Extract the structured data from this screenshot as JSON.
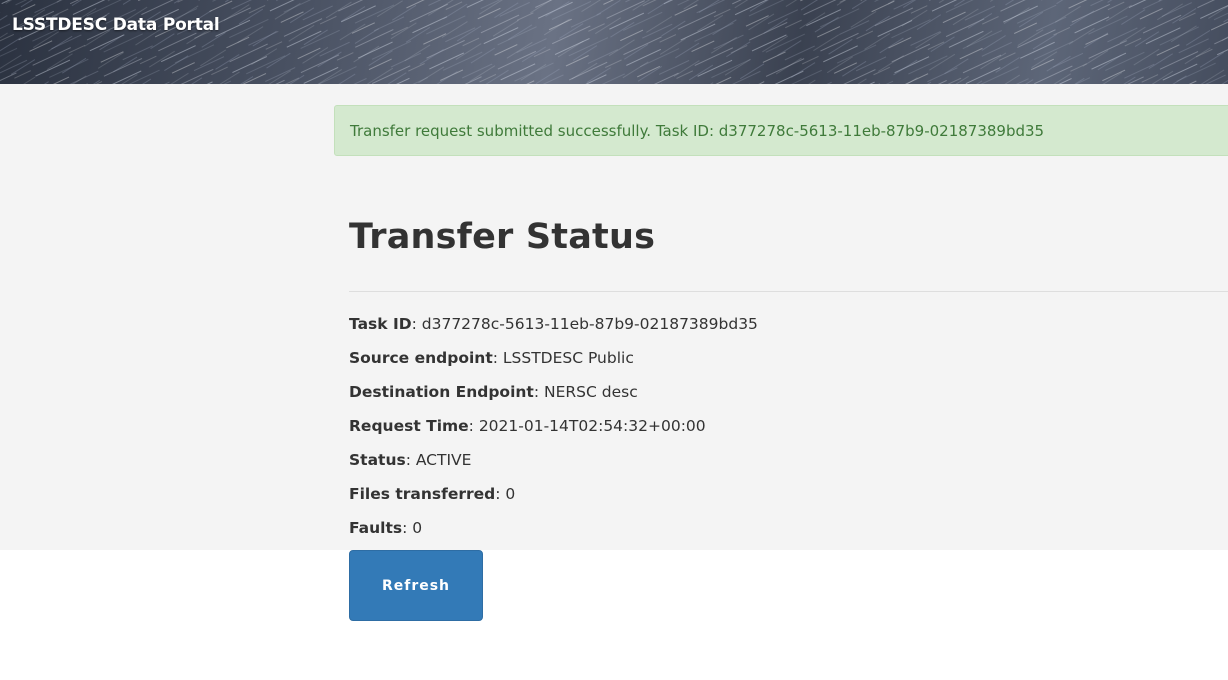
{
  "header": {
    "brand": "LSSTDESC Data Portal"
  },
  "alert": {
    "message": "Transfer request submitted successfully. Task ID: d377278c-5613-11eb-87b9-02187389bd35"
  },
  "page": {
    "title": "Transfer Status"
  },
  "transfer": {
    "fields": [
      {
        "label": "Task ID",
        "value": ": d377278c-5613-11eb-87b9-02187389bd35"
      },
      {
        "label": "Source endpoint",
        "value": ": LSSTDESC Public"
      },
      {
        "label": "Destination Endpoint",
        "value": ": NERSC desc"
      },
      {
        "label": "Request Time",
        "value": ": 2021-01-14T02:54:32+00:00"
      },
      {
        "label": "Status",
        "value": ": ACTIVE"
      },
      {
        "label": "Files transferred",
        "value": ": 0"
      },
      {
        "label": "Faults",
        "value": ": 0"
      }
    ]
  },
  "actions": {
    "refresh_label": "Refresh"
  },
  "colors": {
    "alert_bg": "#d4e9cf",
    "alert_text": "#3f7a3a",
    "button_bg": "#337ab7",
    "page_bg": "#f4f4f4"
  }
}
